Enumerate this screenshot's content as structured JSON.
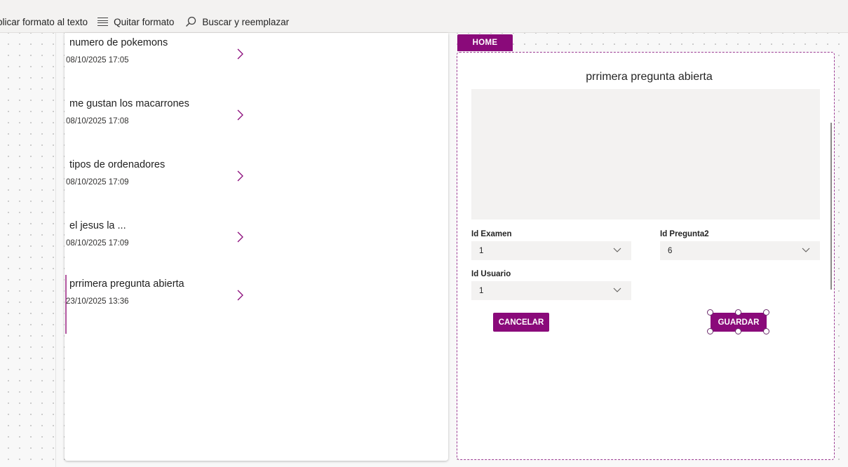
{
  "toolbar": {
    "apply_format": "plicar formato al texto",
    "clear_format": "Quitar formato",
    "find_replace": "Buscar y reemplazar"
  },
  "gallery": {
    "items": [
      {
        "title": "numero de pokemons",
        "date": "08/10/2025 17:05"
      },
      {
        "title": "me gustan los macarrones",
        "date": "08/10/2025 17:08"
      },
      {
        "title": "tipos de ordenadores",
        "date": "08/10/2025 17:09"
      },
      {
        "title": "el jesus la ...",
        "date": "08/10/2025 17:09"
      },
      {
        "title": "prrimera pregunta abierta",
        "date": "23/10/2025 13:36"
      }
    ]
  },
  "form": {
    "home_tab": "HOME",
    "title": "prrimera pregunta abierta",
    "answer_value": "",
    "id_examen": {
      "label": "Id Examen",
      "value": "1"
    },
    "id_pregunta": {
      "label": "Id Pregunta2",
      "value": "6"
    },
    "id_usuario": {
      "label": "Id Usuario",
      "value": "1"
    },
    "cancel_label": "CANCELAR",
    "save_label": "GUARDAR"
  },
  "colors": {
    "accent": "#8a0a7a",
    "selection_bar": "#b1579f",
    "field_bg": "#f3f2f1"
  }
}
